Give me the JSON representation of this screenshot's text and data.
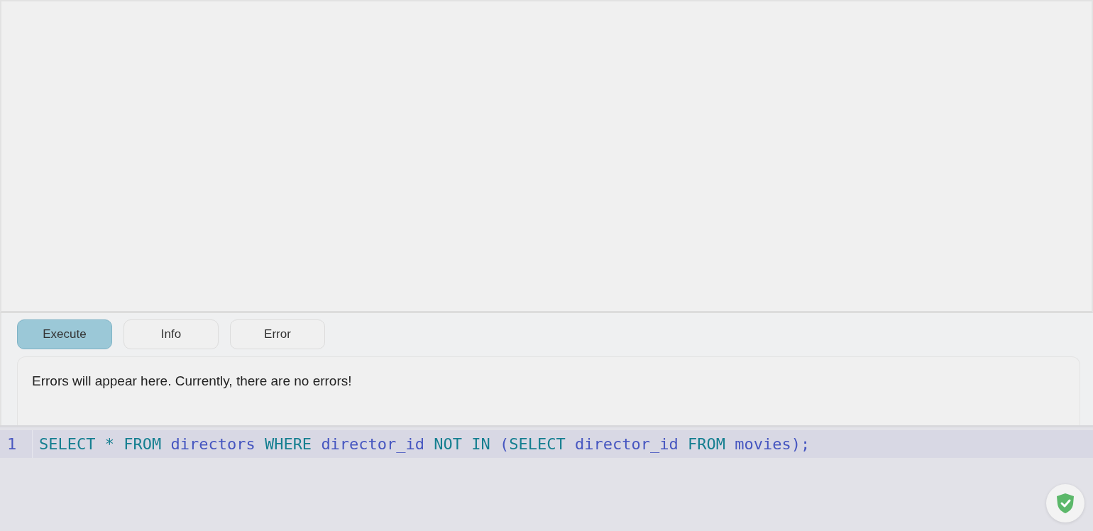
{
  "tabs": [
    {
      "label": "Execute",
      "selected": true
    },
    {
      "label": "Info",
      "selected": false
    },
    {
      "label": "Error",
      "selected": false
    }
  ],
  "message": "Errors will appear here. Currently, there are no errors!",
  "editor": {
    "lines": [
      {
        "number": "1",
        "active": true,
        "tokens": [
          {
            "text": "SELECT * FROM ",
            "kind": "keyword"
          },
          {
            "text": "directors ",
            "kind": "identifier"
          },
          {
            "text": "WHERE ",
            "kind": "keyword"
          },
          {
            "text": "director_id ",
            "kind": "identifier"
          },
          {
            "text": "NOT IN ",
            "kind": "keyword"
          },
          {
            "text": "(",
            "kind": "identifier"
          },
          {
            "text": "SELECT ",
            "kind": "keyword"
          },
          {
            "text": "director_id ",
            "kind": "identifier"
          },
          {
            "text": "FROM ",
            "kind": "keyword"
          },
          {
            "text": "movies);",
            "kind": "identifier"
          }
        ]
      }
    ]
  }
}
